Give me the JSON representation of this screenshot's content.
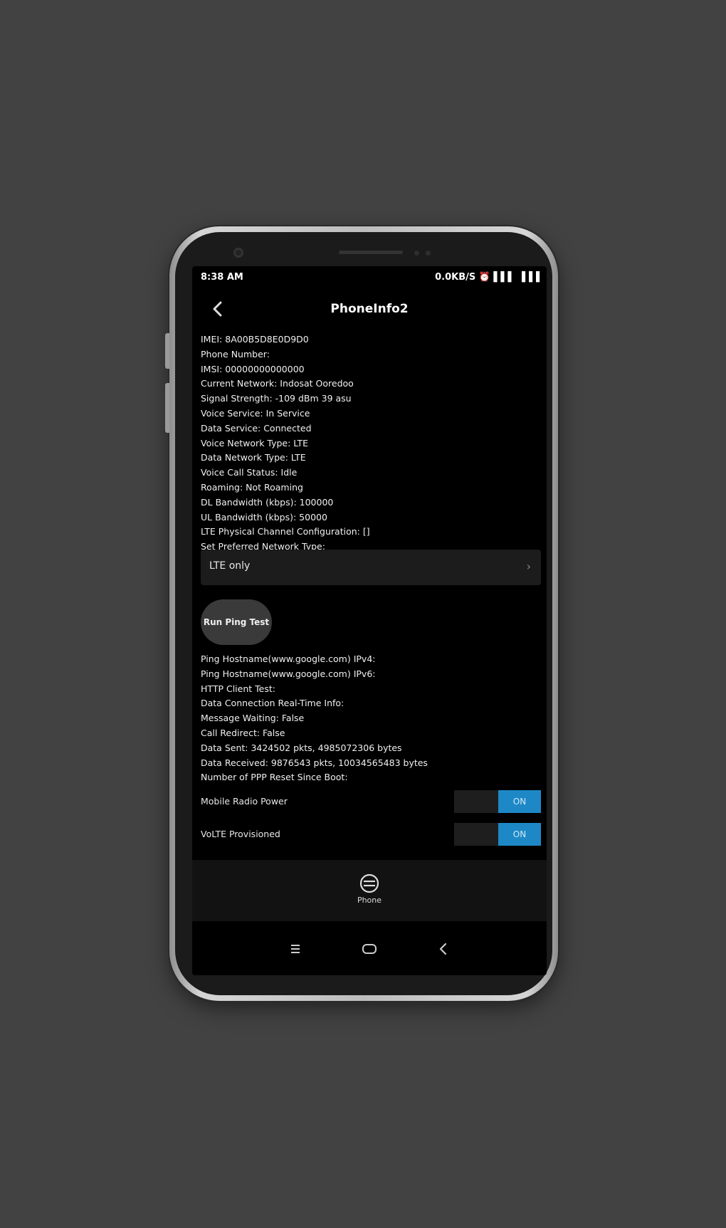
{
  "status_bar": {
    "time": "8:38 AM",
    "right_icons": "0.0KB/S ⏰ ▌▌▌ ▐▐▐"
  },
  "app_bar": {
    "title": "PhoneInfo2"
  },
  "info_lines": [
    "IMEI: 8A00B5D8E0D9D0",
    "Phone Number:",
    "IMSI: 00000000000000",
    "Current Network: Indosat Ooredoo",
    "Signal Strength: -109 dBm 39 asu",
    "Voice Service: In Service",
    "Data Service: Connected",
    "Voice Network Type: LTE",
    "Data Network Type: LTE",
    "Voice Call Status: Idle",
    "Roaming: Not Roaming",
    "DL Bandwidth (kbps): 100000",
    "UL Bandwidth (kbps): 50000",
    "LTE Physical Channel Configuration: []",
    "Set Preferred Network Type:"
  ],
  "network_select": {
    "value": "LTE only",
    "chevron": "›"
  },
  "ping_button": {
    "label": "Run Ping Test"
  },
  "info_lines_2": [
    "Ping Hostname(www.google.com) IPv4:",
    "Ping Hostname(www.google.com) IPv6:",
    "HTTP Client Test:",
    "Data Connection Real-Time Info:",
    "Message Waiting: False",
    "Call Redirect: False",
    "Data Sent: 3424502 pkts, 4985072306 bytes",
    "Data Received: 9876543 pkts, 10034565483 bytes",
    "Number of PPP Reset Since Boot:"
  ],
  "toggles": [
    {
      "label": "Mobile Radio Power",
      "state": "ON"
    },
    {
      "label": "VoLTE Provisioned",
      "state": "ON"
    }
  ],
  "bottom_nav": {
    "item_label": "Phone"
  }
}
